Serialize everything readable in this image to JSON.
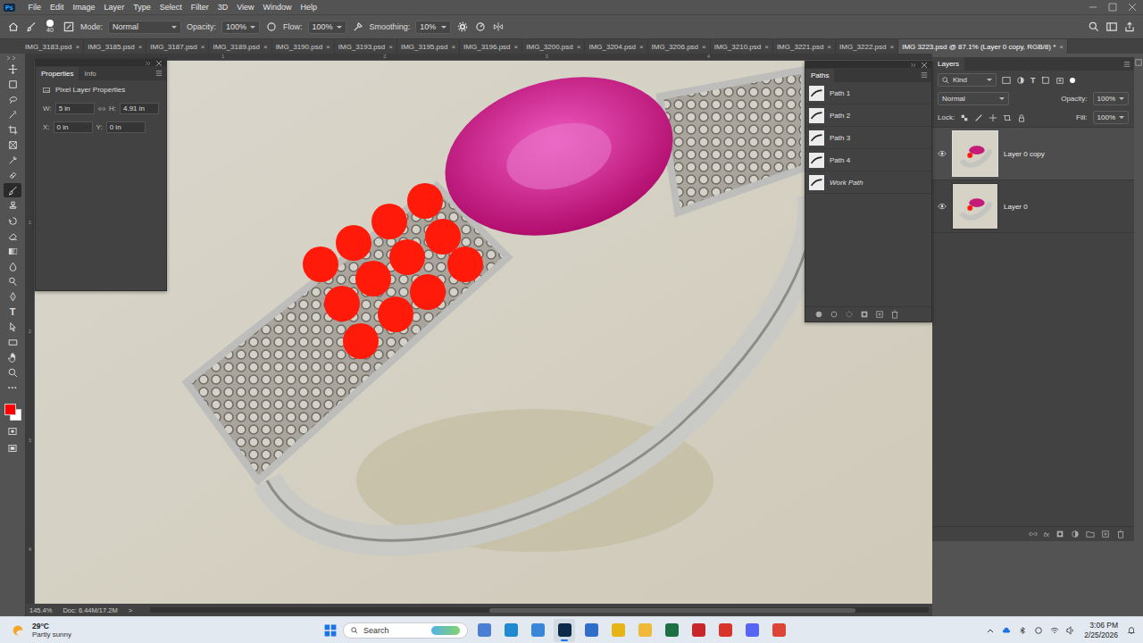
{
  "app": {
    "logo": "Ps"
  },
  "menu": [
    "File",
    "Edit",
    "Image",
    "Layer",
    "Type",
    "Select",
    "Filter",
    "3D",
    "View",
    "Window",
    "Help"
  ],
  "options_bar": {
    "brush_size": "40",
    "mode_label": "Mode:",
    "mode": "Normal",
    "opacity_label": "Opacity:",
    "opacity": "100%",
    "flow_label": "Flow:",
    "flow": "100%",
    "smoothing_label": "Smoothing:",
    "smoothing": "10%"
  },
  "tab_close": "×",
  "tabs": [
    {
      "label": "IMG_3183.psd",
      "selected": false
    },
    {
      "label": "IMG_3185.psd",
      "selected": false
    },
    {
      "label": "IMG_3187.psd",
      "selected": false
    },
    {
      "label": "IMG_3189.psd",
      "selected": false
    },
    {
      "label": "IMG_3190.psd",
      "selected": false
    },
    {
      "label": "IMG_3193.psd",
      "selected": false
    },
    {
      "label": "IMG_3195.psd",
      "selected": false
    },
    {
      "label": "IMG_3196.psd",
      "selected": false
    },
    {
      "label": "IMG_3200.psd",
      "selected": false
    },
    {
      "label": "IMG_3204.psd",
      "selected": false
    },
    {
      "label": "IMG_3206.psd",
      "selected": false
    },
    {
      "label": "IMG_3210.psd",
      "selected": false
    },
    {
      "label": "IMG_3221.psd",
      "selected": false
    },
    {
      "label": "IMG_3222.psd",
      "selected": false
    },
    {
      "label": "IMG 3223.psd @ 87.1% (Layer 0 copy, RGB/8) *",
      "selected": true
    }
  ],
  "tools": [
    {
      "kind": "move",
      "selected": false
    },
    {
      "kind": "marquee",
      "selected": false
    },
    {
      "kind": "lasso",
      "selected": false
    },
    {
      "kind": "wand",
      "selected": false
    },
    {
      "kind": "crop",
      "selected": false
    },
    {
      "kind": "frame",
      "selected": false
    },
    {
      "kind": "eyedropper",
      "selected": false
    },
    {
      "kind": "heal",
      "selected": false
    },
    {
      "kind": "brush",
      "selected": true
    },
    {
      "kind": "stamp",
      "selected": false
    },
    {
      "kind": "history",
      "selected": false
    },
    {
      "kind": "eraser",
      "selected": false
    },
    {
      "kind": "gradient",
      "selected": false
    },
    {
      "kind": "blur",
      "selected": false
    },
    {
      "kind": "dodge",
      "selected": false
    },
    {
      "kind": "pen",
      "selected": false
    },
    {
      "kind": "type",
      "glyph": "T",
      "selected": false
    },
    {
      "kind": "select",
      "selected": false
    },
    {
      "kind": "shape",
      "selected": false
    },
    {
      "kind": "hand",
      "selected": false
    },
    {
      "kind": "zoom",
      "selected": false
    },
    {
      "kind": "more",
      "glyph": "···",
      "selected": false
    }
  ],
  "swatches": {
    "foreground": "#ff0000",
    "background": "#ffffff"
  },
  "rulers": {
    "horizontal": [
      "1",
      "2",
      "3",
      "4"
    ],
    "vertical": [
      "1",
      "2",
      "3",
      "4"
    ]
  },
  "properties_panel": {
    "tabs": [
      {
        "label": "Properties",
        "selected": true
      },
      {
        "label": "Info",
        "selected": false
      }
    ],
    "title": "Pixel Layer Properties",
    "size_fields": [
      {
        "label": "W:",
        "value": "5 in"
      },
      {
        "label": "H:",
        "value": "4.91 in"
      }
    ],
    "position_fields": [
      {
        "label": "X:",
        "value": "0 in"
      },
      {
        "label": "Y:",
        "value": "0 in"
      }
    ]
  },
  "paths_panel": {
    "title": "Paths",
    "items": [
      {
        "label": "Path 1",
        "italic": false
      },
      {
        "label": "Path 2",
        "italic": false
      },
      {
        "label": "Path 3",
        "italic": false
      },
      {
        "label": "Path 4",
        "italic": false
      },
      {
        "label": "Work Path",
        "italic": true
      }
    ]
  },
  "layers_panel": {
    "title": "Layers",
    "filter": "Kind",
    "filter_type_glyph": "T",
    "blend_mode": "Normal",
    "opacity_label": "Opacity:",
    "opacity": "100%",
    "lock_label": "Lock:",
    "fill_label": "Fill:",
    "fill": "100%",
    "fx_label": "fx",
    "layers": [
      {
        "name": "Layer 0 copy",
        "visible": true,
        "selected": true
      },
      {
        "name": "Layer 0",
        "visible": true,
        "selected": false
      }
    ]
  },
  "status_bar": {
    "zoom": "145.4%",
    "doc": "Doc: 6.44M/17.2M",
    "arrow": ">"
  },
  "taskbar": {
    "temperature": "29°C",
    "weather": "Partly sunny",
    "search_placeholder": "Search",
    "time": "3:06 PM",
    "date": "2/25/2026",
    "apps": [
      {
        "kind": "files",
        "selected": false
      },
      {
        "kind": "edge",
        "selected": false
      },
      {
        "kind": "store",
        "selected": false
      },
      {
        "kind": "photoshop",
        "selected": true
      },
      {
        "kind": "mail",
        "selected": false
      },
      {
        "kind": "chrome",
        "selected": false
      },
      {
        "kind": "explorer",
        "selected": false
      },
      {
        "kind": "excel",
        "selected": false
      },
      {
        "kind": "acrobat",
        "selected": false
      },
      {
        "kind": "app-red",
        "selected": false
      },
      {
        "kind": "discord",
        "selected": false
      },
      {
        "kind": "chrome-alt",
        "selected": false
      }
    ]
  }
}
